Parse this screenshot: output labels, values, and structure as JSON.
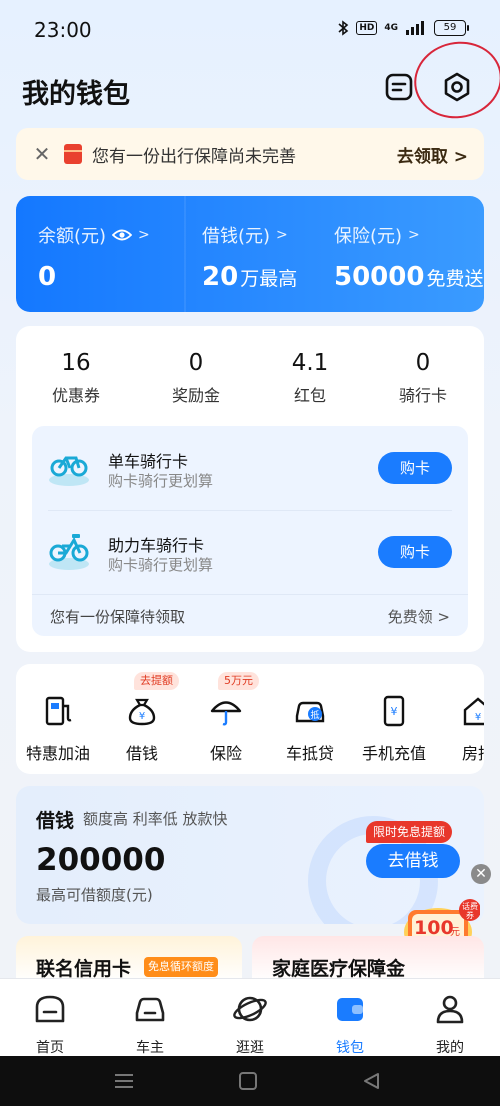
{
  "status_bar": {
    "time": "23:00",
    "hd": "HD",
    "network": "4G",
    "battery": "59"
  },
  "header": {
    "title": "我的钱包"
  },
  "notice": {
    "text": "您有一份出行保障尚未完善",
    "action": "去领取",
    "action_chevron": ">"
  },
  "balance_card": {
    "items": [
      {
        "label": "余额(元)",
        "value": "0",
        "suffix": ""
      },
      {
        "label": "借钱(元)",
        "value": "20",
        "suffix": "万最高"
      },
      {
        "label": "保险(元)",
        "value": "50000",
        "suffix": "免费送"
      }
    ],
    "chevron": ">"
  },
  "assets": {
    "stats": [
      {
        "value": "16",
        "label": "优惠券"
      },
      {
        "value": "0",
        "label": "奖励金"
      },
      {
        "value": "4.1",
        "label": "红包"
      },
      {
        "value": "0",
        "label": "骑行卡"
      }
    ],
    "ride_cards": [
      {
        "title": "单车骑行卡",
        "subtitle": "购卡骑行更划算",
        "button": "购卡"
      },
      {
        "title": "助力车骑行卡",
        "subtitle": "购卡骑行更划算",
        "button": "购卡"
      }
    ],
    "footer_text": "您有一份保障待领取",
    "footer_link": "免费领 >"
  },
  "services": {
    "items": [
      {
        "label": "特惠加油",
        "tag": "",
        "icon": "fuel-pump-icon"
      },
      {
        "label": "借钱",
        "tag": "去提额",
        "icon": "money-bag-icon"
      },
      {
        "label": "保险",
        "tag": "5万元",
        "icon": "umbrella-icon"
      },
      {
        "label": "车抵贷",
        "tag": "",
        "icon": "car-loan-icon"
      },
      {
        "label": "手机充值",
        "tag": "",
        "icon": "phone-recharge-icon"
      },
      {
        "label": "房抵",
        "tag": "",
        "icon": "house-loan-icon"
      }
    ]
  },
  "loan_card": {
    "title": "借钱",
    "tags": "额度高 利率低 放款快",
    "amount": "200000",
    "amount_label": "最高可借额度(元)",
    "button": "去借钱",
    "badge": "限时免息提额"
  },
  "coupon_fab": {
    "amount": "100",
    "unit": "元",
    "tag": "话费券"
  },
  "promos": [
    {
      "title": "联名信用卡",
      "tag": "免息循环额度"
    },
    {
      "title": "家庭医疗保障金",
      "tag": ""
    }
  ],
  "tab_bar": {
    "items": [
      {
        "label": "首页",
        "icon": "home-icon",
        "active": false
      },
      {
        "label": "车主",
        "icon": "car-icon",
        "active": false
      },
      {
        "label": "逛逛",
        "icon": "planet-icon",
        "active": false
      },
      {
        "label": "钱包",
        "icon": "wallet-icon",
        "active": true
      },
      {
        "label": "我的",
        "icon": "person-icon",
        "active": false
      }
    ]
  },
  "colors": {
    "accent": "#1a7cff",
    "annotation_circle": "#d8263a",
    "tag_red": "#e8372b"
  }
}
